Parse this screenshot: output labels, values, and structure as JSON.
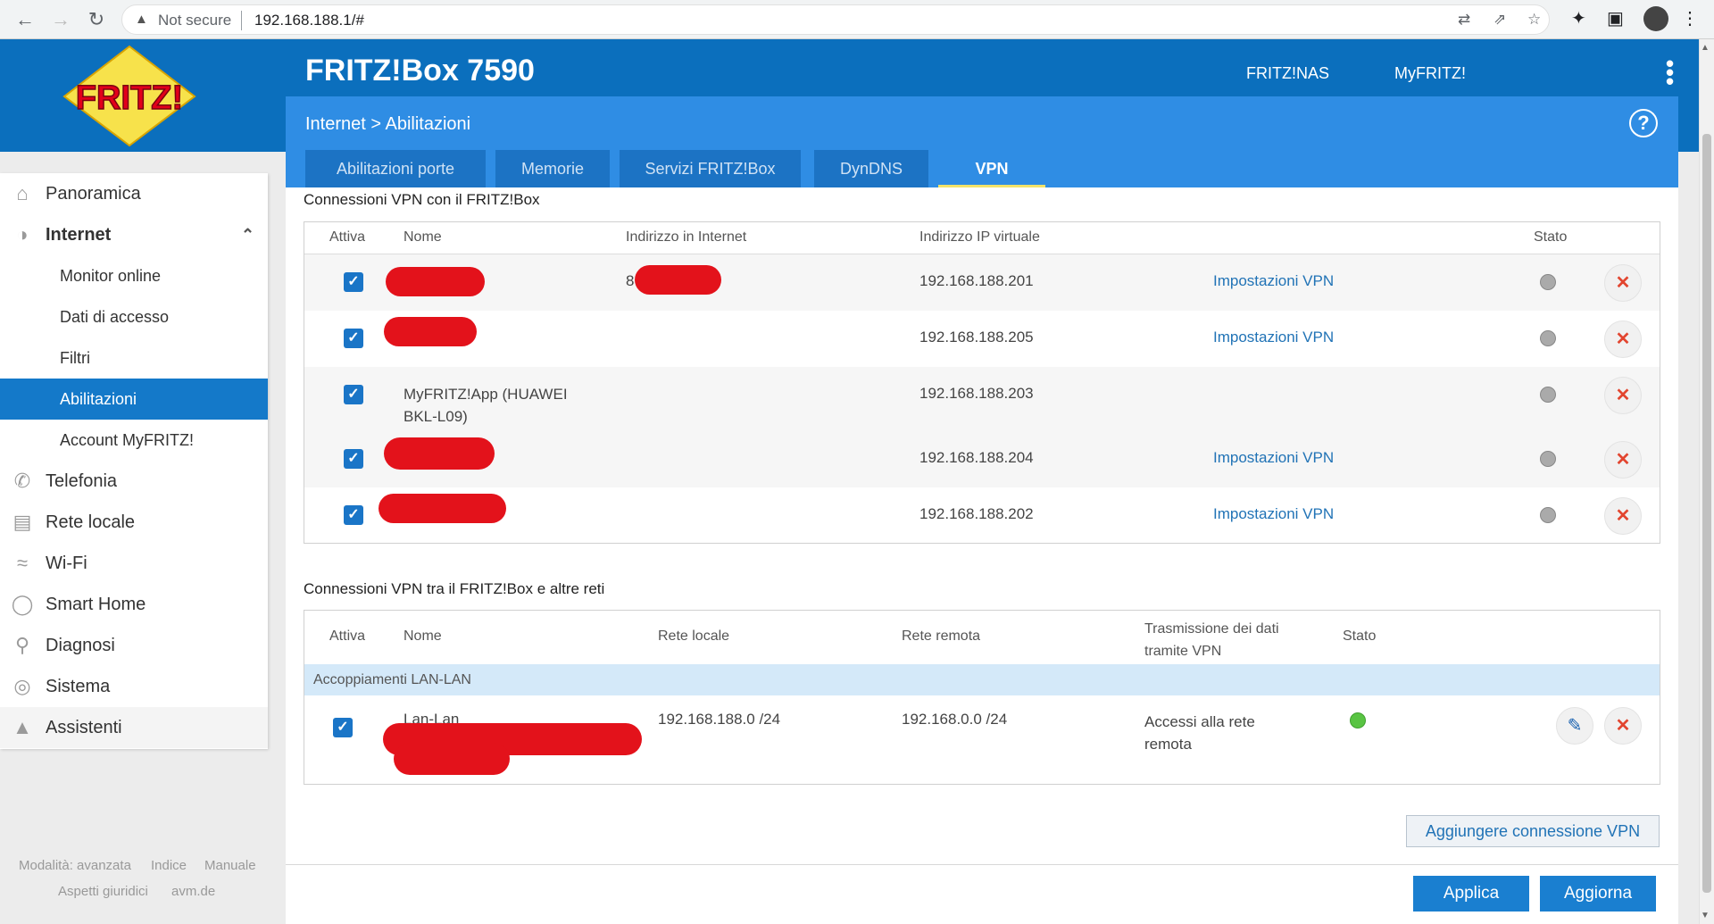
{
  "browser": {
    "security_label": "Not secure",
    "url": "192.168.188.1/#"
  },
  "header": {
    "product": "FRITZ!Box 7590",
    "links": [
      "FRITZ!NAS",
      "MyFRITZ!"
    ],
    "breadcrumb": "Internet > Abilitazioni",
    "tabs": [
      "Abilitazioni porte",
      "Memorie",
      "Servizi FRITZ!Box",
      "DynDNS",
      "VPN"
    ],
    "active_tab": "VPN"
  },
  "sidebar": {
    "items": [
      {
        "label": "Panoramica",
        "icon": "home-icon"
      },
      {
        "label": "Internet",
        "icon": "globe-icon"
      },
      {
        "label": "Telefonia",
        "icon": "phone-icon"
      },
      {
        "label": "Rete locale",
        "icon": "network-icon"
      },
      {
        "label": "Wi-Fi",
        "icon": "wifi-icon"
      },
      {
        "label": "Smart Home",
        "icon": "smarthome-icon"
      },
      {
        "label": "Diagnosi",
        "icon": "diagnosis-icon"
      },
      {
        "label": "Sistema",
        "icon": "system-icon"
      },
      {
        "label": "Assistenti",
        "icon": "wizard-icon"
      }
    ],
    "internet_sub": [
      "Monitor online",
      "Dati di accesso",
      "Filtri",
      "Abilitazioni",
      "Account MyFRITZ!"
    ],
    "active_sub": "Abilitazioni",
    "footer": {
      "mode": "Modalità: avanzata",
      "index": "Indice",
      "manual": "Manuale",
      "legal": "Aspetti giuridici",
      "avm": "avm.de"
    }
  },
  "vpn_users": {
    "title": "Connessioni VPN con il FRITZ!Box",
    "headers": [
      "Attiva",
      "Nome",
      "Indirizzo in Internet",
      "Indirizzo IP virtuale",
      "Stato"
    ],
    "rows": [
      {
        "name": "",
        "internet": "8",
        "ip": "192.168.188.201",
        "link": "Impostazioni VPN"
      },
      {
        "name": "",
        "internet": "",
        "ip": "192.168.188.205",
        "link": "Impostazioni VPN"
      },
      {
        "name": "MyFRITZ!App (HUAWEI BKL-L09)",
        "internet": "",
        "ip": "192.168.188.203",
        "link": ""
      },
      {
        "name": "",
        "internet": "",
        "ip": "192.168.188.204",
        "link": "Impostazioni VPN"
      },
      {
        "name": "",
        "internet": "",
        "ip": "192.168.188.202",
        "link": "Impostazioni VPN"
      }
    ]
  },
  "vpn_networks": {
    "title": "Connessioni VPN tra il FRITZ!Box e altre reti",
    "headers": [
      "Attiva",
      "Nome",
      "Rete locale",
      "Rete remota",
      "Trasmissione dei dati tramite VPN",
      "Stato"
    ],
    "group": "Accoppiamenti LAN-LAN",
    "rows": [
      {
        "name": "Lan-Lan",
        "local": "192.168.188.0 /24",
        "remote": "192.168.0.0 /24",
        "transfer": "Accessi alla rete remota",
        "status": "connected"
      }
    ]
  },
  "actions": {
    "add": "Aggiungere connessione VPN",
    "apply": "Applica",
    "refresh": "Aggiorna"
  },
  "colors": {
    "brand_blue": "#0b6fbd",
    "light_blue": "#2f8de4",
    "active_nav": "#1479c9",
    "link": "#2173b6",
    "delete_red": "#e2452f",
    "status_green": "#59c443"
  }
}
